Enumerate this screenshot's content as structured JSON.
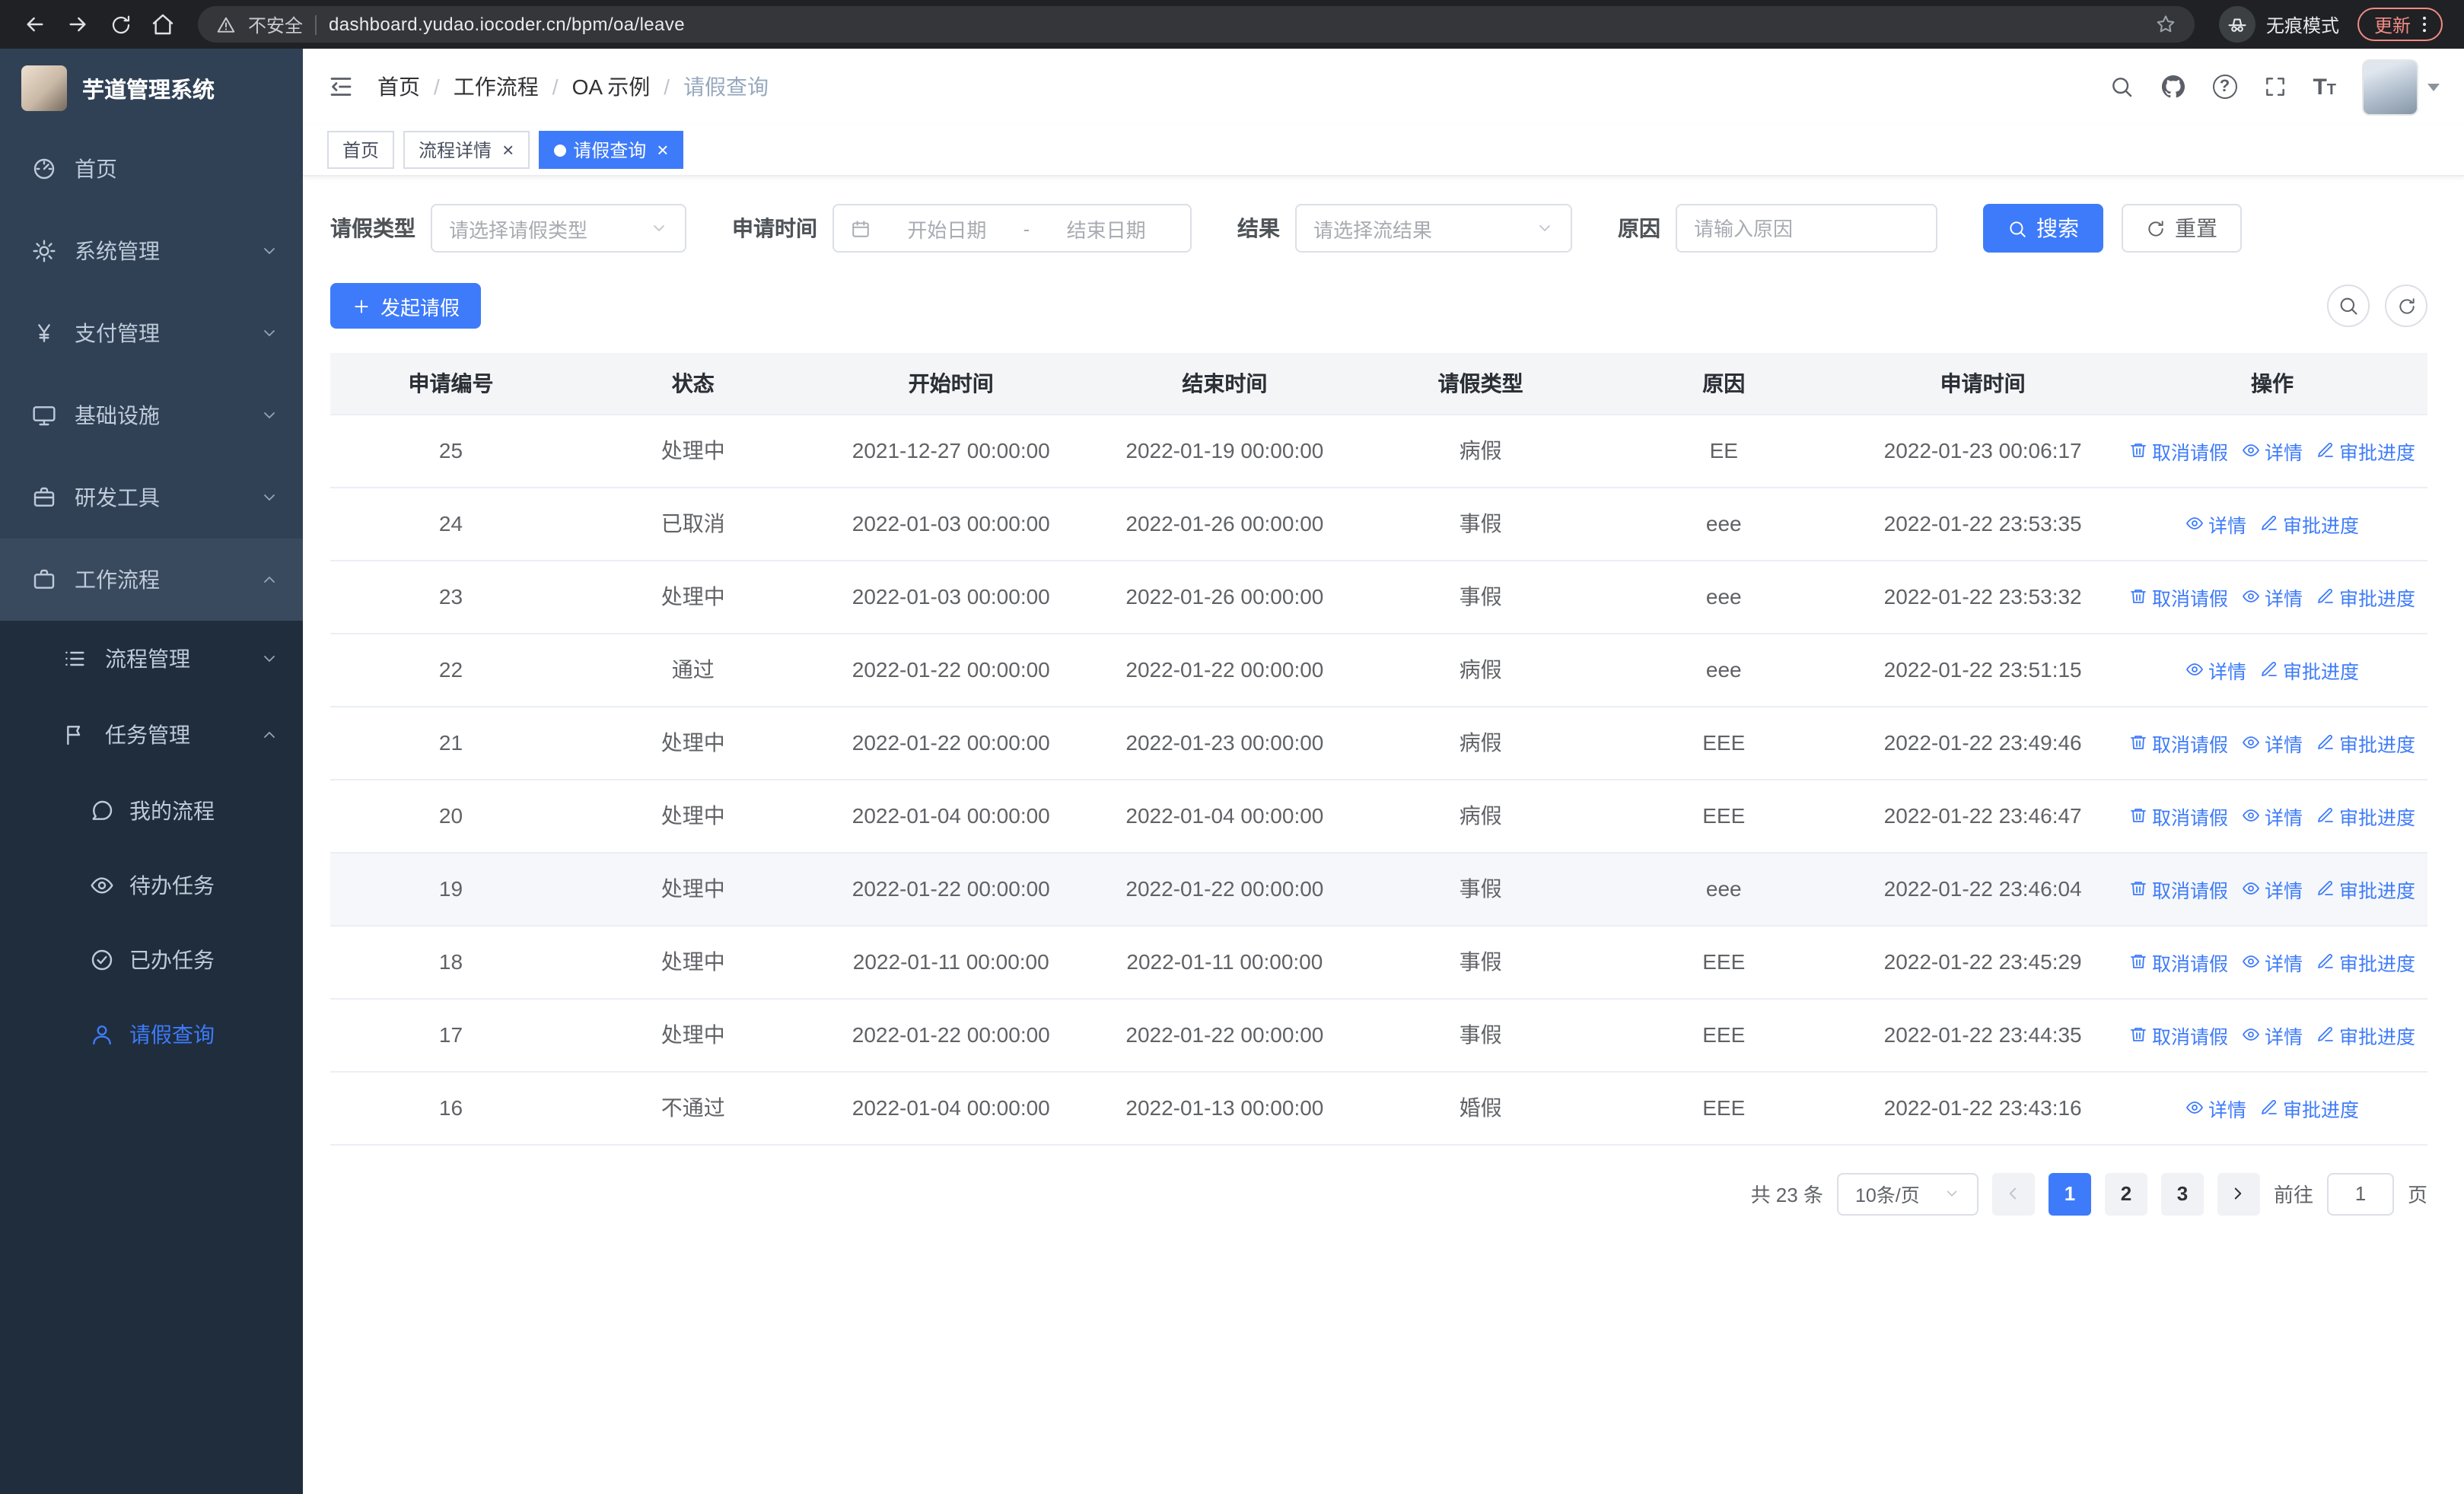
{
  "colors": {
    "accent": "#3e7bfa",
    "sidebar_bg": "#304156",
    "submenu_bg": "#1f2d3d"
  },
  "browser": {
    "security_warning": "不安全",
    "url": "dashboard.yudao.iocoder.cn/bpm/oa/leave",
    "incognito_label": "无痕模式",
    "update_label": "更新"
  },
  "sidebar": {
    "app_title": "芋道管理系统",
    "items": [
      {
        "key": "home",
        "label": "首页",
        "icon": "dashboard"
      },
      {
        "key": "system",
        "label": "系统管理",
        "icon": "gear",
        "expandable": true
      },
      {
        "key": "payment",
        "label": "支付管理",
        "icon": "yen",
        "expandable": true
      },
      {
        "key": "infra",
        "label": "基础设施",
        "icon": "monitor",
        "expandable": true
      },
      {
        "key": "devtools",
        "label": "研发工具",
        "icon": "briefcase",
        "expandable": true
      },
      {
        "key": "workflow",
        "label": "工作流程",
        "icon": "suitcase",
        "expandable": true,
        "expanded": true,
        "highlight": true
      }
    ],
    "submenu": [
      {
        "key": "process-mgmt",
        "label": "流程管理",
        "icon": "list",
        "expandable": true
      },
      {
        "key": "task-mgmt",
        "label": "任务管理",
        "icon": "flag",
        "expandable": true,
        "expanded": true
      }
    ],
    "leaves": [
      {
        "key": "my-process",
        "label": "我的流程",
        "icon": "chat"
      },
      {
        "key": "todo-tasks",
        "label": "待办任务",
        "icon": "eye"
      },
      {
        "key": "done-tasks",
        "label": "已办任务",
        "icon": "check"
      },
      {
        "key": "leave-query",
        "label": "请假查询",
        "icon": "user",
        "active": true
      }
    ]
  },
  "header": {
    "breadcrumb": [
      "首页",
      "工作流程",
      "OA 示例",
      "请假查询"
    ]
  },
  "tabs": [
    {
      "key": "home",
      "label": "首页",
      "closable": false,
      "active": false
    },
    {
      "key": "process-detail",
      "label": "流程详情",
      "closable": true,
      "active": false
    },
    {
      "key": "leave-query",
      "label": "请假查询",
      "closable": true,
      "active": true
    }
  ],
  "filters": {
    "leave_type_label": "请假类型",
    "leave_type_placeholder": "请选择请假类型",
    "apply_time_label": "申请时间",
    "date_start_placeholder": "开始日期",
    "date_separator": "-",
    "date_end_placeholder": "结束日期",
    "result_label": "结果",
    "result_placeholder": "请选择流结果",
    "reason_label": "原因",
    "reason_placeholder": "请输入原因",
    "search_label": "搜索",
    "reset_label": "重置"
  },
  "toolbar": {
    "create_label": "发起请假"
  },
  "table": {
    "columns": [
      "申请编号",
      "状态",
      "开始时间",
      "结束时间",
      "请假类型",
      "原因",
      "申请时间",
      "操作"
    ],
    "column_widths": [
      11.5,
      11.6,
      13,
      13.1,
      11.3,
      11.9,
      12.8,
      14.8
    ],
    "action_labels": {
      "cancel": "取消请假",
      "detail": "详情",
      "progress": "审批进度"
    },
    "rows": [
      {
        "id": "25",
        "status": "处理中",
        "start": "2021-12-27 00:00:00",
        "end": "2022-01-19 00:00:00",
        "type": "病假",
        "reason": "EE",
        "applied": "2022-01-23 00:06:17",
        "actions": [
          "cancel",
          "detail",
          "progress"
        ]
      },
      {
        "id": "24",
        "status": "已取消",
        "start": "2022-01-03 00:00:00",
        "end": "2022-01-26 00:00:00",
        "type": "事假",
        "reason": "eee",
        "applied": "2022-01-22 23:53:35",
        "actions": [
          "detail",
          "progress"
        ]
      },
      {
        "id": "23",
        "status": "处理中",
        "start": "2022-01-03 00:00:00",
        "end": "2022-01-26 00:00:00",
        "type": "事假",
        "reason": "eee",
        "applied": "2022-01-22 23:53:32",
        "actions": [
          "cancel",
          "detail",
          "progress"
        ]
      },
      {
        "id": "22",
        "status": "通过",
        "start": "2022-01-22 00:00:00",
        "end": "2022-01-22 00:00:00",
        "type": "病假",
        "reason": "eee",
        "applied": "2022-01-22 23:51:15",
        "actions": [
          "detail",
          "progress"
        ]
      },
      {
        "id": "21",
        "status": "处理中",
        "start": "2022-01-22 00:00:00",
        "end": "2022-01-23 00:00:00",
        "type": "病假",
        "reason": "EEE",
        "applied": "2022-01-22 23:49:46",
        "actions": [
          "cancel",
          "detail",
          "progress"
        ]
      },
      {
        "id": "20",
        "status": "处理中",
        "start": "2022-01-04 00:00:00",
        "end": "2022-01-04 00:00:00",
        "type": "病假",
        "reason": "EEE",
        "applied": "2022-01-22 23:46:47",
        "actions": [
          "cancel",
          "detail",
          "progress"
        ]
      },
      {
        "id": "19",
        "status": "处理中",
        "start": "2022-01-22 00:00:00",
        "end": "2022-01-22 00:00:00",
        "type": "事假",
        "reason": "eee",
        "applied": "2022-01-22 23:46:04",
        "actions": [
          "cancel",
          "detail",
          "progress"
        ],
        "highlight": true
      },
      {
        "id": "18",
        "status": "处理中",
        "start": "2022-01-11 00:00:00",
        "end": "2022-01-11 00:00:00",
        "type": "事假",
        "reason": "EEE",
        "applied": "2022-01-22 23:45:29",
        "actions": [
          "cancel",
          "detail",
          "progress"
        ]
      },
      {
        "id": "17",
        "status": "处理中",
        "start": "2022-01-22 00:00:00",
        "end": "2022-01-22 00:00:00",
        "type": "事假",
        "reason": "EEE",
        "applied": "2022-01-22 23:44:35",
        "actions": [
          "cancel",
          "detail",
          "progress"
        ]
      },
      {
        "id": "16",
        "status": "不通过",
        "start": "2022-01-04 00:00:00",
        "end": "2022-01-13 00:00:00",
        "type": "婚假",
        "reason": "EEE",
        "applied": "2022-01-22 23:43:16",
        "actions": [
          "detail",
          "progress"
        ]
      }
    ]
  },
  "pagination": {
    "total_label": "共 23 条",
    "page_size": "10条/页",
    "pages": [
      "1",
      "2",
      "3"
    ],
    "active_page": "1",
    "goto_label": "前往",
    "goto_value": "1",
    "page_suffix": "页"
  }
}
